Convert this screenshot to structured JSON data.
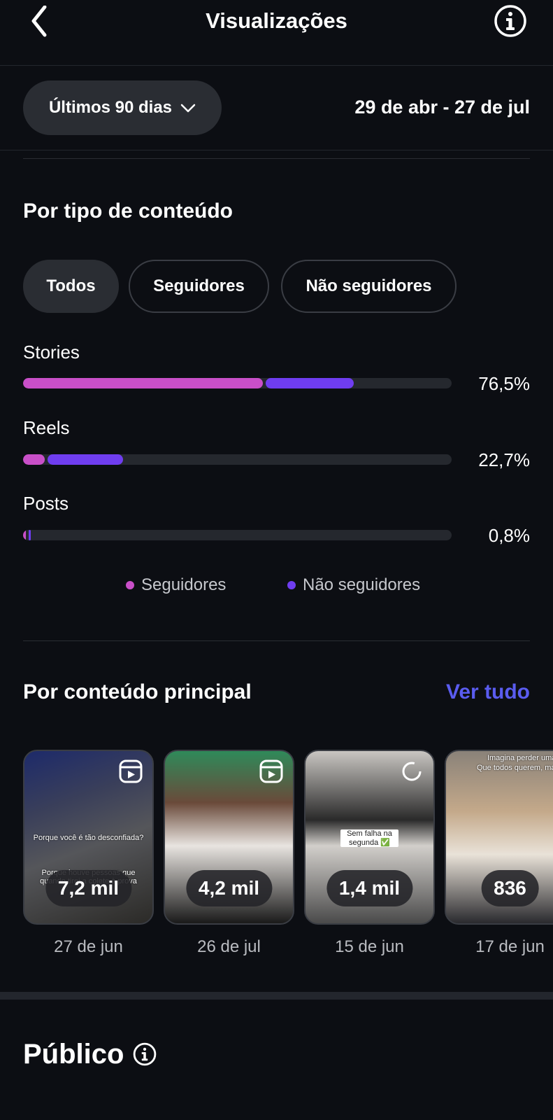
{
  "header": {
    "title": "Visualizações",
    "back_icon": "chevron-left-icon",
    "info_icon": "info-icon"
  },
  "filters": {
    "range_label": "Últimos 90 dias",
    "date_range": "29 de abr - 27 de jul"
  },
  "content_type": {
    "title": "Por tipo de conteúdo",
    "tabs": [
      {
        "label": "Todos",
        "active": true
      },
      {
        "label": "Seguidores",
        "active": false
      },
      {
        "label": "Não seguidores",
        "active": false
      }
    ],
    "rows": [
      {
        "label": "Stories",
        "pct": "76,5%",
        "followers_pct": 55.9,
        "nonfollowers_pct": 20.6
      },
      {
        "label": "Reels",
        "pct": "22,7%",
        "followers_pct": 5.0,
        "nonfollowers_pct": 17.7
      },
      {
        "label": "Posts",
        "pct": "0,8%",
        "followers_pct": 0.4,
        "nonfollowers_pct": 0.4
      }
    ],
    "legend": {
      "followers": "Seguidores",
      "nonfollowers": "Não seguidores"
    },
    "colors": {
      "followers": "#c94fc8",
      "nonfollowers": "#6f3df0",
      "track": "#25282e"
    }
  },
  "top_content": {
    "title": "Por conteúdo principal",
    "see_all": "Ver tudo",
    "items": [
      {
        "views": "7,2 mil",
        "date": "27 de jun",
        "overlay_1": "Porque você é tão desconfiada?",
        "overlay_2": "Porque houve pessoas que quando tirei a colete à prova"
      },
      {
        "views": "4,2 mil",
        "date": "26 de jul"
      },
      {
        "views": "1,4 mil",
        "date": "15 de jun",
        "overlay_1": "Sem falha na segunda ✅"
      },
      {
        "views": "836",
        "date": "17 de jun",
        "overlay_1": "Imagina perder uma mulher",
        "overlay_2": "Que todos querem, mas ela qu"
      }
    ]
  },
  "audience": {
    "title": "Público"
  }
}
